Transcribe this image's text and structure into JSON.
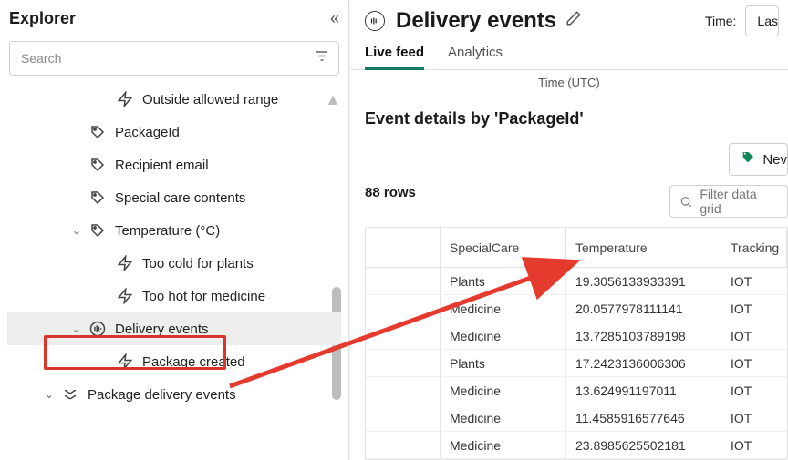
{
  "sidebar": {
    "title": "Explorer",
    "search_placeholder": "Search",
    "items": [
      {
        "icon": "bolt",
        "label": "Outside allowed range",
        "indent": 116
      },
      {
        "icon": "tag",
        "label": "PackageId",
        "indent": 86
      },
      {
        "icon": "tag",
        "label": "Recipient email",
        "indent": 86
      },
      {
        "icon": "tag",
        "label": "Special care contents",
        "indent": 86
      },
      {
        "icon": "tag",
        "label": "Temperature (°C)",
        "indent": 86,
        "chev": true
      },
      {
        "icon": "bolt",
        "label": "Too cold for plants",
        "indent": 116
      },
      {
        "icon": "bolt",
        "label": "Too hot for medicine",
        "indent": 116
      },
      {
        "icon": "stream",
        "label": "Delivery events",
        "indent": 86,
        "chev": true,
        "selected": true
      },
      {
        "icon": "bolt",
        "label": "Package created",
        "indent": 116
      },
      {
        "icon": "flow",
        "label": "Package delivery events",
        "indent": 56,
        "chev": true
      }
    ]
  },
  "header": {
    "title": "Delivery events",
    "time_label": "Time:",
    "time_value": "Las"
  },
  "tabs": {
    "live": "Live feed",
    "analytics": "Analytics"
  },
  "time_utc": "Time (UTC)",
  "details": {
    "title": "Event details by 'PackageId'",
    "rowcount": "88 rows",
    "new_label": "Nev",
    "filter_placeholder": "Filter data grid"
  },
  "columns": {
    "special": "SpecialCare",
    "temp": "Temperature",
    "track": "Tracking"
  },
  "chart_data": {
    "type": "table",
    "columns": [
      "SpecialCare",
      "Temperature",
      "Tracking"
    ],
    "rows": [
      {
        "special": "Plants",
        "temp": "19.3056133933391",
        "track": "IOT"
      },
      {
        "special": "Medicine",
        "temp": "20.0577978111141",
        "track": "IOT"
      },
      {
        "special": "Medicine",
        "temp": "13.7285103789198",
        "track": "IOT"
      },
      {
        "special": "Plants",
        "temp": "17.2423136006306",
        "track": "IOT"
      },
      {
        "special": "Medicine",
        "temp": "13.624991197011",
        "track": "IOT"
      },
      {
        "special": "Medicine",
        "temp": "11.4585916577646",
        "track": "IOT"
      },
      {
        "special": "Medicine",
        "temp": "23.8985625502181",
        "track": "IOT"
      }
    ]
  }
}
